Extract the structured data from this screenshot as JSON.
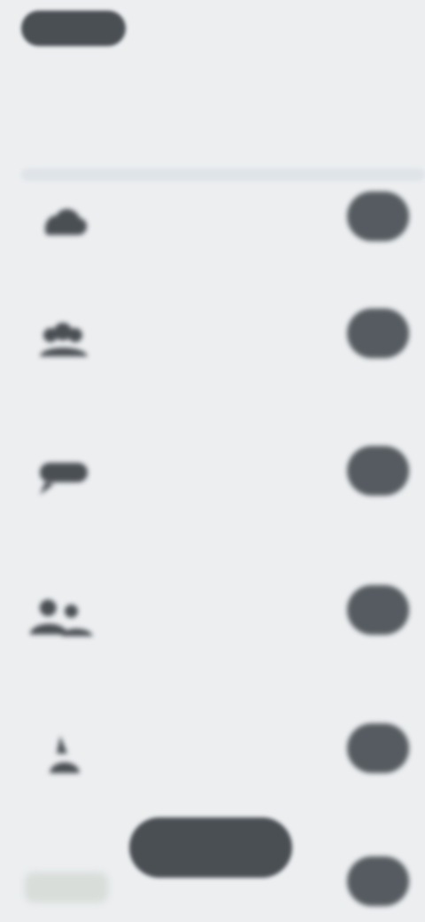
{
  "header": {
    "back_label": "",
    "action_label": "",
    "subtitle": ""
  },
  "section": {
    "title": ""
  },
  "rows": [
    {
      "title": "",
      "subtitle": ""
    },
    {
      "title": "",
      "subtitle": ""
    },
    {
      "title": "",
      "subtitle": ""
    },
    {
      "title": "",
      "subtitle": ""
    },
    {
      "title": "",
      "subtitle": ""
    },
    {
      "title": "",
      "subtitle": ""
    }
  ],
  "icons": {
    "row0": "cloud-icon",
    "row1": "group-icon",
    "row2": "chat-icon",
    "row3": "people-icon",
    "row4": "person-icon",
    "row5": "tag-icon"
  },
  "colors": {
    "background": "#eceef0",
    "pill": "#555b60",
    "text_primary": "#5a6066",
    "text_secondary": "#a4abb1"
  }
}
